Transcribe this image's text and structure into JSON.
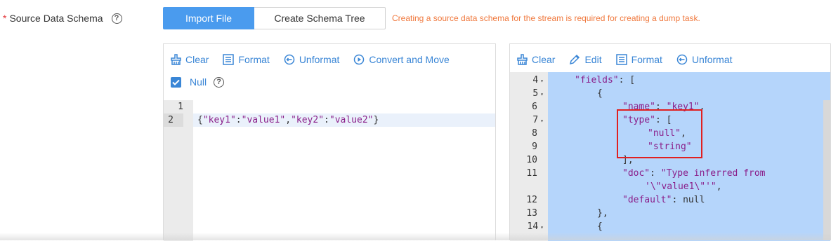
{
  "form": {
    "required_mark": "*",
    "label": "Source Data Schema",
    "help": "?"
  },
  "tabs": {
    "import_file": "Import File",
    "create_schema_tree": "Create Schema Tree",
    "hint": "Creating a source data schema for the stream is required for creating a dump task."
  },
  "left_panel": {
    "toolbar": {
      "clear": "Clear",
      "format": "Format",
      "unformat": "Unformat",
      "convert": "Convert and Move"
    },
    "null_label": "Null",
    "null_checked": true,
    "lines": [
      "1",
      "2"
    ],
    "code_line2": {
      "p1": "{",
      "k1": "\"key1\"",
      "c1": ":",
      "v1": "\"value1\"",
      "m1": ",",
      "k2": "\"key2\"",
      "c2": ":",
      "v2": "\"value2\"",
      "p2": "}"
    }
  },
  "right_panel": {
    "toolbar": {
      "clear": "Clear",
      "edit": "Edit",
      "format": "Format",
      "unformat": "Unformat"
    },
    "lines": [
      "4",
      "5",
      "6",
      "7",
      "8",
      "9",
      "10",
      "11",
      "",
      "12",
      "13",
      "14"
    ],
    "code": {
      "l4_key": "\"fields\"",
      "l4_rest": ": [",
      "l5": "{",
      "l6_key": "\"name\"",
      "l6_colon": ": ",
      "l6_val": "\"key1\"",
      "l6_end": ",",
      "l7_key": "\"type\"",
      "l7_rest": ": [",
      "l8": "\"null\"",
      "l8_end": ",",
      "l9": "\"string\"",
      "l10": "],",
      "l11_key": "\"doc\"",
      "l11_colon": ": ",
      "l11_val": "\"Type inferred from",
      "l11b_val": "'\\\"value1\\\"'\"",
      "l11b_end": ",",
      "l12_key": "\"default\"",
      "l12_rest": ": null",
      "l13": "},",
      "l14": "{"
    }
  },
  "colors": {
    "accent": "#3a86d6",
    "tab_active": "#4a9bee",
    "hint": "#f0793e",
    "selection": "#b5d5fb",
    "highlight_box": "#e02020"
  }
}
